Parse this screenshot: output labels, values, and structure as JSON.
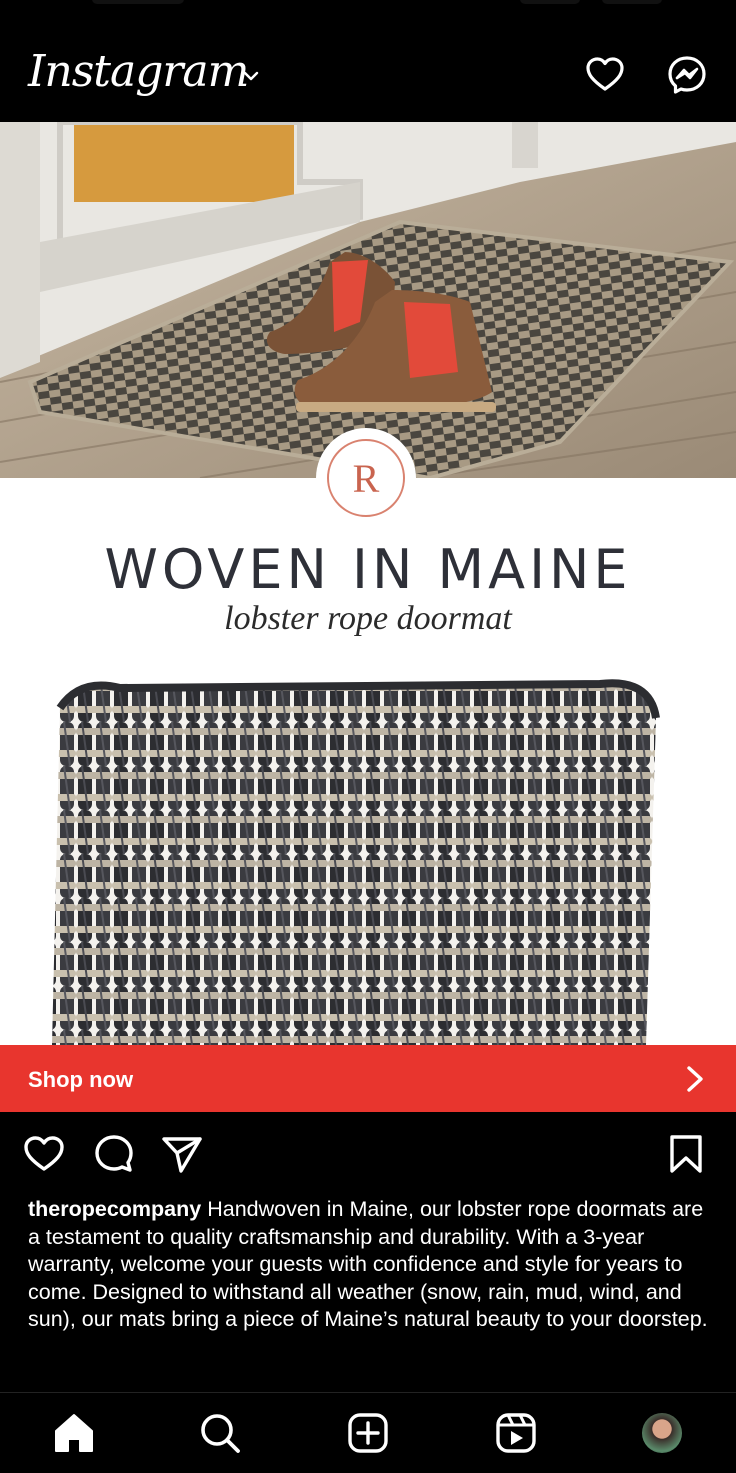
{
  "app": {
    "title": "Instagram"
  },
  "ad": {
    "brand_initial": "R",
    "headline": "WOVEN IN MAINE",
    "subheadline": "lobster rope doormat"
  },
  "cta": {
    "label": "Shop now"
  },
  "post": {
    "username": "theropecompany",
    "caption": "Handwoven in Maine, our lobster rope doormats are a testament to quality craftsmanship and durability. With a 3-year warranty, welcome your guests with confidence and style for years to come. Designed to withstand all weather (snow, rain, mud, wind, and sun), our mats bring a piece of Maine’s natural beauty to your doorstep."
  },
  "colors": {
    "cta": "#e8352e",
    "background": "#000000",
    "headline": "#2e3038",
    "brand_accent": "#c9644f"
  },
  "icons": {
    "header": [
      "heart-icon",
      "messenger-icon"
    ],
    "actions": [
      "like-icon",
      "comment-icon",
      "share-icon",
      "save-icon"
    ],
    "nav": [
      "home-icon",
      "search-icon",
      "create-icon",
      "reels-icon",
      "profile-avatar"
    ]
  }
}
